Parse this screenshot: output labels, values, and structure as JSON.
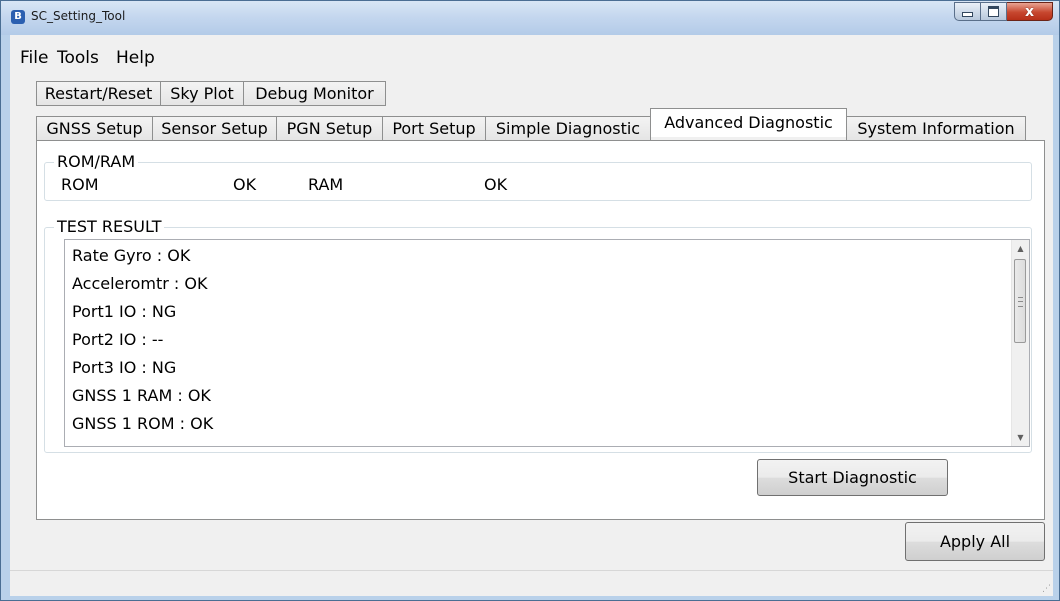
{
  "window": {
    "title": "SC_Setting_Tool",
    "app_icon": "B"
  },
  "menu": [
    "File",
    "Tools",
    "Help"
  ],
  "tabs_row1": [
    "Restart/Reset",
    "Sky Plot",
    "Debug Monitor"
  ],
  "tabs_row2": [
    "GNSS Setup",
    "Sensor Setup",
    "PGN Setup",
    "Port Setup",
    "Simple Diagnostic",
    "Advanced Diagnostic",
    "System Information"
  ],
  "active_tab": "Advanced Diagnostic",
  "rom_ram": {
    "title": "ROM/RAM",
    "rom_label": "ROM",
    "rom_value": "OK",
    "ram_label": "RAM",
    "ram_value": "OK"
  },
  "test_result": {
    "title": "TEST RESULT",
    "lines": [
      "Rate Gyro : OK",
      "Acceleromtr : OK",
      "Port1 IO : NG",
      "Port2 IO : --",
      "Port3 IO : NG",
      "GNSS 1 RAM : OK",
      "GNSS 1 ROM : OK"
    ]
  },
  "buttons": {
    "start_diagnostic": "Start Diagnostic",
    "apply_all": "Apply All"
  },
  "icons": {
    "minimize": "minimize-icon",
    "maximize": "maximize-icon",
    "close": "close-icon",
    "size_grip": "size-grip-icon"
  },
  "colors": {
    "titlebar": "#c3d6ee",
    "close_button": "#c7472f",
    "client_bg": "#f0f0f0"
  }
}
